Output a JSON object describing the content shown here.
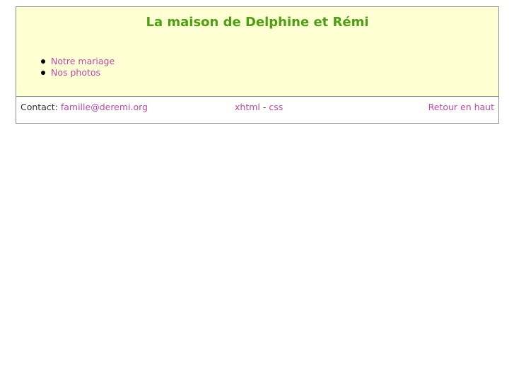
{
  "header": {
    "title": "La maison de Delphine et Rémi"
  },
  "nav": {
    "items": [
      {
        "label": "Notre mariage"
      },
      {
        "label": "Nos photos"
      }
    ]
  },
  "footer": {
    "contact_label": "Contact:",
    "contact_email": "famille@deremi.org",
    "xhtml_link": "xhtml",
    "separator": "-",
    "css_link": "css",
    "back_to_top": "Retour en haut"
  },
  "colors": {
    "header_background": "#ffffd4",
    "title": "#4aa010",
    "link": "#c047a8",
    "border": "#8e8e8e"
  }
}
